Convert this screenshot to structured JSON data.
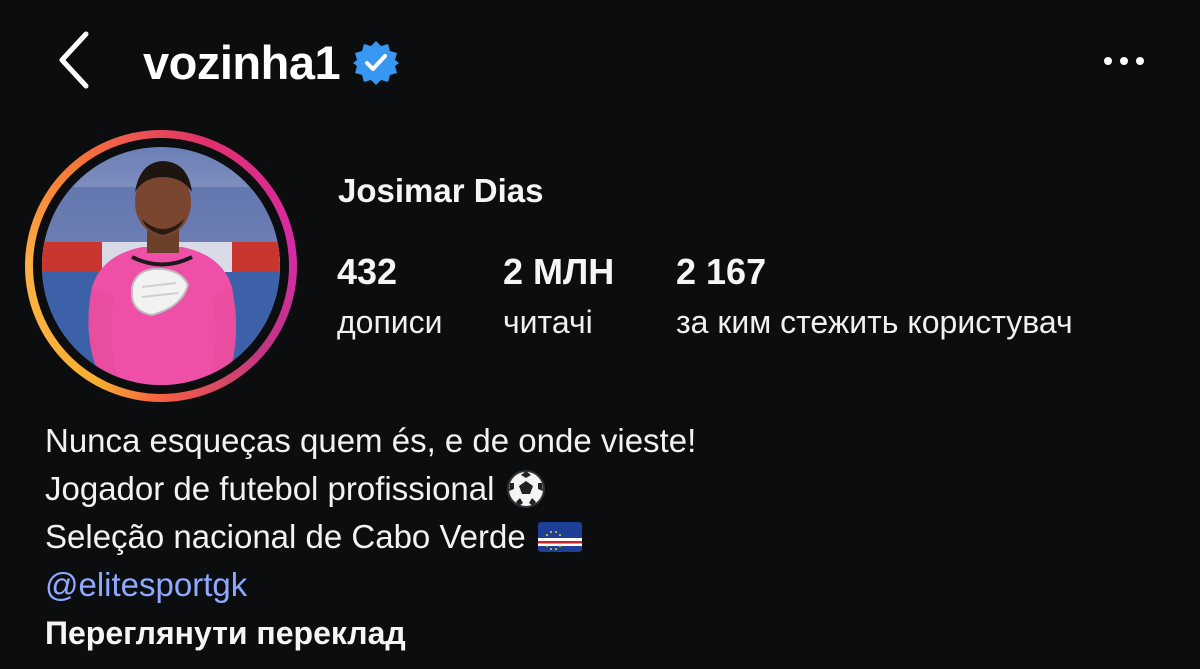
{
  "header": {
    "username": "vozinha1",
    "verified": true,
    "icons": {
      "back": "chevron-left-icon",
      "verified": "verified-badge-icon",
      "more": "more-horizontal-icon"
    }
  },
  "profile": {
    "full_name": "Josimar Dias",
    "avatar": "avatar-photo-goalkeeper",
    "story_ring_colors": [
      "#f8b133",
      "#f77737",
      "#e1306c",
      "#c13584"
    ],
    "stats": {
      "posts": {
        "value": "432",
        "label": "дописи"
      },
      "followers": {
        "value": "2 МЛН",
        "label": "читачі"
      },
      "following": {
        "value": "2 167",
        "label": "за ким стежить користувач"
      }
    }
  },
  "bio": {
    "line1": "Nunca esqueças quem és, e de onde vieste!",
    "line2": "Jogador de futebol profissional",
    "line2_emoji": "soccer-ball-icon",
    "line3": "Seleção nacional de Cabo Verde",
    "line3_emoji": "cape-verde-flag-icon",
    "link": "@elitesportgk",
    "translate": "Переглянути переклад"
  },
  "colors": {
    "background": "#0c0d0f",
    "link": "#8fa9ff",
    "verified": "#3897f0"
  }
}
